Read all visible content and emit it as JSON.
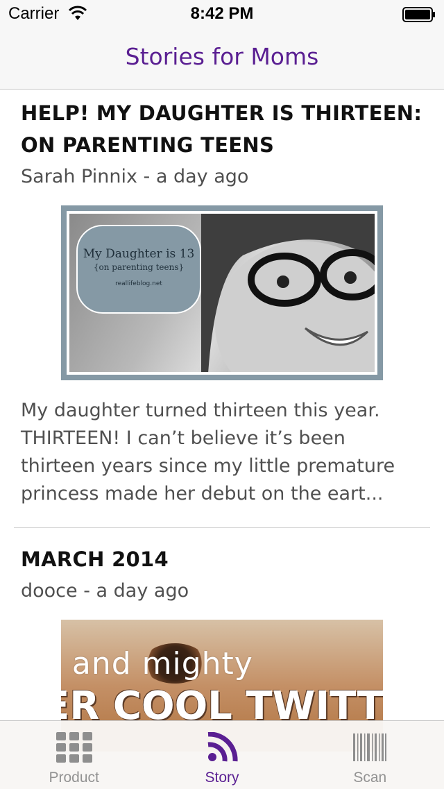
{
  "status_bar": {
    "carrier": "Carrier",
    "time": "8:42 PM"
  },
  "nav": {
    "title": "Stories for Moms",
    "title_color": "#5a1f92"
  },
  "stories": [
    {
      "title": "HELP! MY DAUGHTER IS THIRTEEN: ON PARENTING TEENS",
      "meta": "Sarah Pinnix - a day ago",
      "image": {
        "badge_title": "My Daughter is 13",
        "badge_subtitle": "{on parenting teens}",
        "badge_url": "reallifeblog.net"
      },
      "excerpt": "My daughter turned thirteen this year. THIRTEEN! I can’t believe it’s been thirteen years since my little premature princess made her debut on the eart..."
    },
    {
      "title": "MARCH 2014",
      "meta": "dooce - a day ago",
      "image": {
        "line1": "h and mighty",
        "line2": "ER COOL TWITTER"
      }
    }
  ],
  "tabbar": {
    "active_color": "#5a1f92",
    "inactive_color": "#929292",
    "tabs": [
      {
        "label": "Product",
        "icon": "grid-icon",
        "active": false
      },
      {
        "label": "Story",
        "icon": "rss-icon",
        "active": true
      },
      {
        "label": "Scan",
        "icon": "barcode-icon",
        "active": false
      }
    ]
  }
}
